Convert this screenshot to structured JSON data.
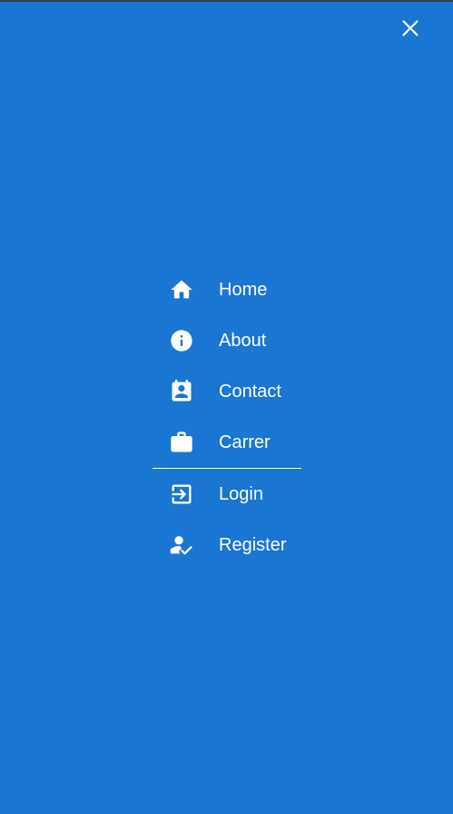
{
  "drawer": {
    "close_icon": "close-icon",
    "colors": {
      "background": "#1976d2",
      "foreground": "#ffffff"
    },
    "primary_items": [
      {
        "label": "Home",
        "icon": "home-icon"
      },
      {
        "label": "About",
        "icon": "info-icon"
      },
      {
        "label": "Contact",
        "icon": "contact-card-icon"
      },
      {
        "label": "Carrer",
        "icon": "briefcase-icon"
      }
    ],
    "secondary_items": [
      {
        "label": "Login",
        "icon": "login-icon"
      },
      {
        "label": "Register",
        "icon": "person-check-icon"
      }
    ]
  }
}
